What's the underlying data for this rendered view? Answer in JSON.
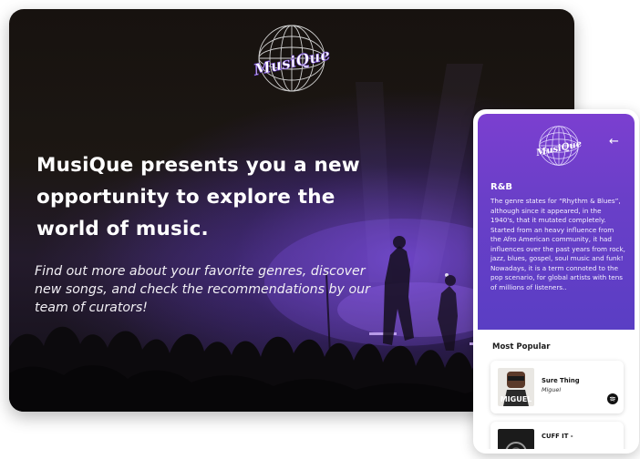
{
  "brand": {
    "name": "MusiQue"
  },
  "hero": {
    "heading": "MusiQue presents you a new opportunity to explore the world of music.",
    "subtitle": "Find out more about your favorite genres, discover new songs, and check the recommendations by our team of curators!"
  },
  "genre": {
    "title": "R&B",
    "description": "The genre states for “Rhythm & Blues”, although since it appeared, in the 1940's, that it mutated completely. Started from an heavy influence from the Afro American community, it had influences over the past years from rock, jazz, blues, gospel, soul music and funk! Nowadays, it is a term connoted to the pop scenario, for global artists with tens of millions of listeners.."
  },
  "popular": {
    "heading": "Most Popular",
    "songs": [
      {
        "title": "Sure Thing",
        "artist": "Miguel"
      },
      {
        "title": "CUFF IT -",
        "artist": ""
      }
    ]
  },
  "icons": {
    "back": "arrow-left-icon",
    "play": "spotify-icon"
  },
  "colors": {
    "accent": "#6a3fc8",
    "hero_bg": "#1c1713",
    "text_light": "#ffffff"
  }
}
